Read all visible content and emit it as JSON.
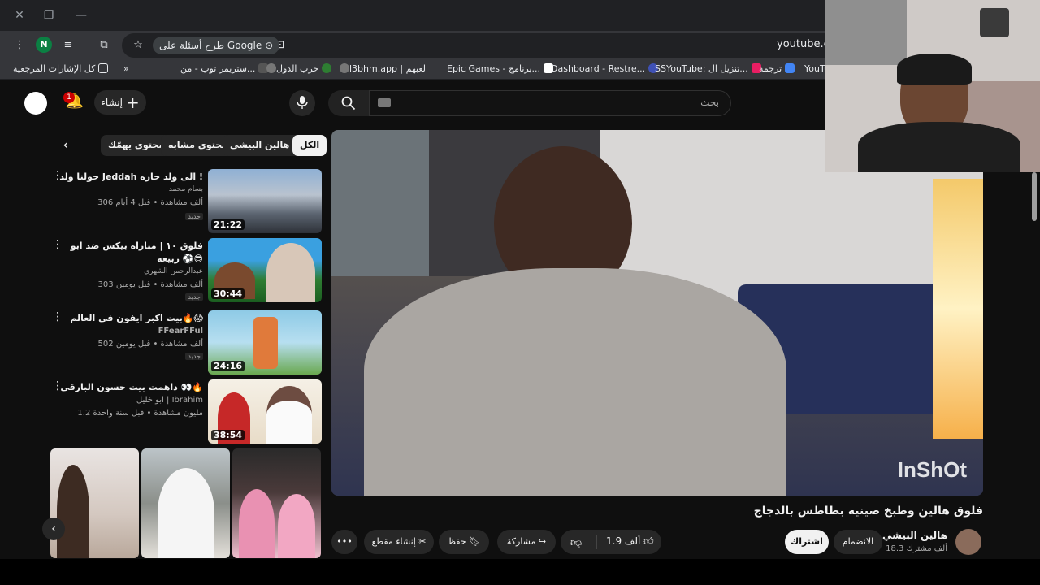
{
  "browser": {
    "ask_google": "طرح أسئلة على Google",
    "url": "youtube.com",
    "profile_initial": "N",
    "bookmarks": [
      {
        "label": "كل الإشارات المرجعية"
      },
      {
        "label": "ستريمر توب - من..."
      },
      {
        "label": "حرب الدول"
      },
      {
        "label": "l3bhm.app | لعبهم"
      },
      {
        "label": "Epic Games - برنامج..."
      },
      {
        "label": "Dashboard - Restre..."
      },
      {
        "label": "SSYouTube: تنزيل ال..."
      },
      {
        "label": "ترجمة"
      },
      {
        "label": "YouTu"
      }
    ]
  },
  "header": {
    "create_label": "إنشاء",
    "notification_count": "1",
    "search_placeholder": "بحث"
  },
  "chips": [
    {
      "label": "الكل",
      "active": true
    },
    {
      "label": "من هالين البيشي"
    },
    {
      "label": "محتوى مشابه"
    },
    {
      "label": "محتوى يهمّك"
    }
  ],
  "related": [
    {
      "title": "حولنا ولد Jeddah الى ولد حاره !",
      "channel": "بسام محمد",
      "meta": "306 ألف مشاهدة • قبل 4 أيام",
      "badge": "جديد",
      "duration": "21:22"
    },
    {
      "title": "فلوق ١٠ | مباراه بيكس ضد ابو ربيعه ⚽😎",
      "channel": "عبدالرحمن الشهري",
      "meta": "303 ألف مشاهدة • قبل يومين",
      "badge": "جديد",
      "duration": "30:44"
    },
    {
      "title": "بيت اكبر ايفون في العالم🔥😱",
      "channel": "FFearFFul",
      "meta": "502 ألف مشاهدة • قبل يومين",
      "badge": "جديد",
      "duration": "24:16"
    },
    {
      "title": "داهمت بيت حسون البارقي 👀🔥",
      "channel": "ابو خليل | Ibrahim",
      "meta": "1.2 مليون مشاهدة • قبل سنة واحدة",
      "badge": "",
      "duration": "38:54"
    }
  ],
  "video": {
    "title": "فلوق هالين وطبخ صينية بطاطس بالدجاج",
    "watermark": "InShOt",
    "channel": "هالين البيشي",
    "subscribers": "18.3 ألف مشترك",
    "join_label": "الانضمام",
    "subscribe_label": "اشتراك",
    "likes": "1.9 ألف",
    "share_label": "مشاركة",
    "save_label": "حفظ",
    "clip_label": "إنشاء مقطع"
  },
  "colors": {
    "background": "#0f0f0f",
    "chip": "#272727",
    "accent": "#cc0000"
  }
}
